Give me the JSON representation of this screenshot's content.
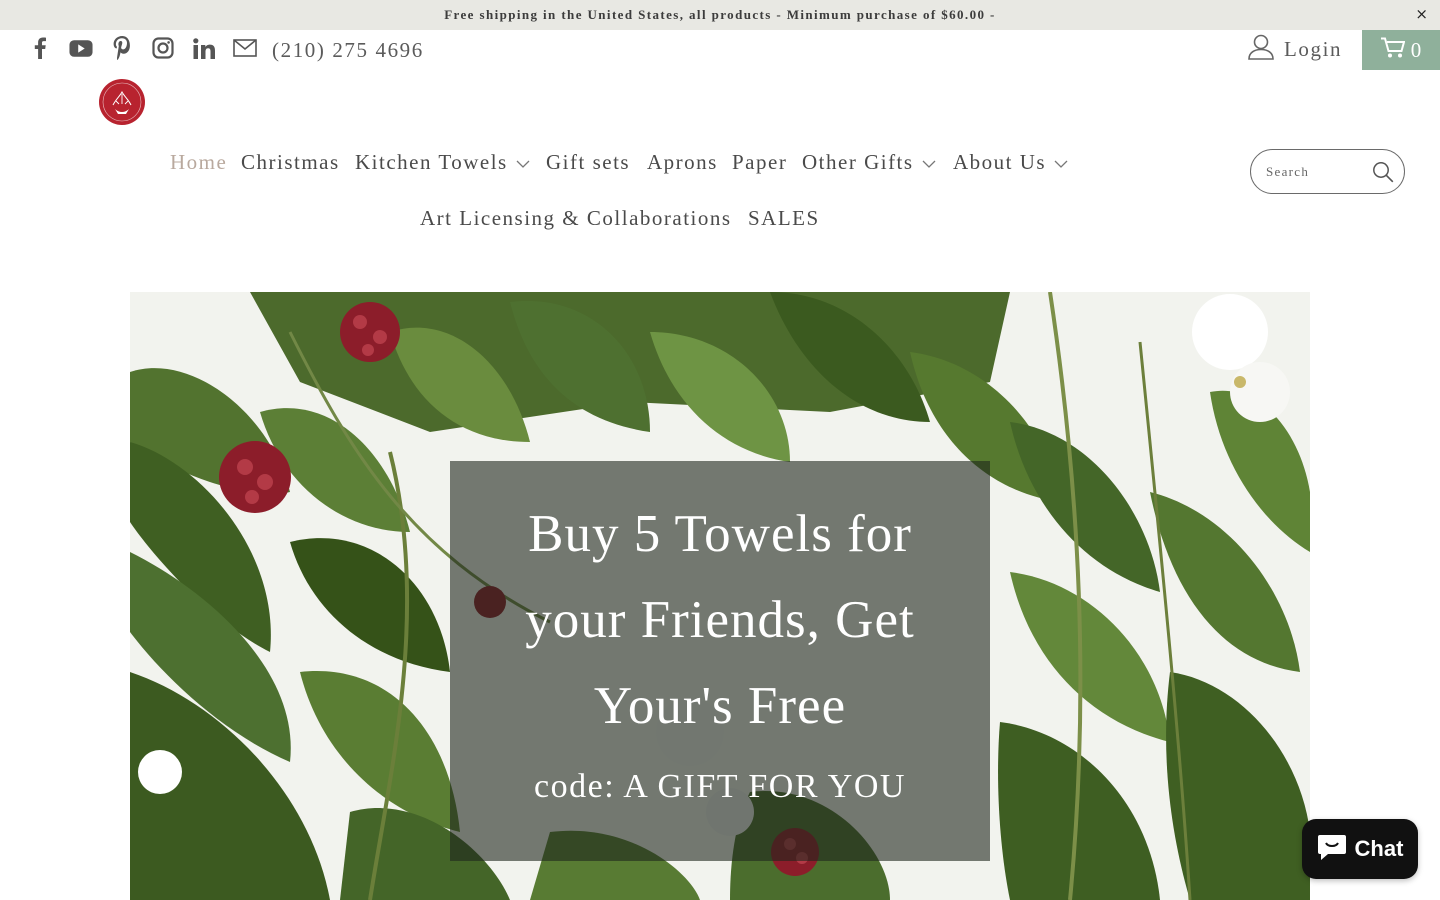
{
  "announcement": {
    "text": "Free shipping in the United States, all products - Minimum purchase of $60.00 -",
    "close_label": "×"
  },
  "header": {
    "social_icons": [
      "facebook-icon",
      "youtube-icon",
      "pinterest-icon",
      "instagram-icon",
      "linkedin-icon",
      "mail-icon"
    ],
    "phone": "(210) 275 4696",
    "login_label": "Login",
    "cart_count": "0",
    "logo_text": "RED BIRD'S NEST"
  },
  "nav": {
    "items": [
      {
        "label": "Home",
        "active": true,
        "dropdown": false
      },
      {
        "label": "Christmas",
        "active": false,
        "dropdown": false
      },
      {
        "label": "Kitchen Towels",
        "active": false,
        "dropdown": true
      },
      {
        "label": "Gift sets",
        "active": false,
        "dropdown": false
      },
      {
        "label": "Aprons",
        "active": false,
        "dropdown": false
      },
      {
        "label": "Paper",
        "active": false,
        "dropdown": false
      },
      {
        "label": "Other Gifts",
        "active": false,
        "dropdown": true
      },
      {
        "label": "About Us",
        "active": false,
        "dropdown": true
      },
      {
        "label": "Art Licensing & Collaborations",
        "active": false,
        "dropdown": false
      },
      {
        "label": "SALES",
        "active": false,
        "dropdown": false
      }
    ]
  },
  "search": {
    "placeholder": "Search",
    "value": ""
  },
  "hero": {
    "title_lines": [
      "Buy 5 Towels for",
      "your Friends, Get",
      "Your's Free"
    ],
    "subtitle": "code: A GIFT FOR YOU"
  },
  "chat": {
    "label": "Chat"
  },
  "colors": {
    "announcement_bg": "#e8e8e3",
    "cart_bg": "#8fb09b",
    "nav_active": "#b9a99e",
    "text": "#4a4a4a",
    "chat_bg": "#111111",
    "logo_red": "#b8232f"
  }
}
